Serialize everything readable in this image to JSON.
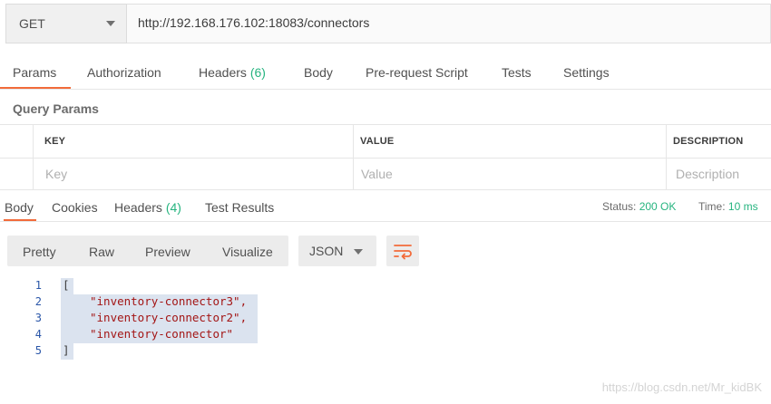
{
  "request": {
    "method": "GET",
    "url": "http://192.168.176.102:18083/connectors"
  },
  "request_tabs": [
    {
      "label": "Params"
    },
    {
      "label": "Authorization"
    },
    {
      "label": "Headers",
      "count": "(6)"
    },
    {
      "label": "Body"
    },
    {
      "label": "Pre-request Script"
    },
    {
      "label": "Tests"
    },
    {
      "label": "Settings"
    }
  ],
  "query_params": {
    "title": "Query Params",
    "columns": [
      "KEY",
      "VALUE",
      "DESCRIPTION"
    ],
    "placeholders": {
      "key": "Key",
      "value": "Value",
      "description": "Description"
    }
  },
  "response_tabs": [
    {
      "label": "Body"
    },
    {
      "label": "Cookies"
    },
    {
      "label": "Headers",
      "count": "(4)"
    },
    {
      "label": "Test Results"
    }
  ],
  "status": {
    "status_label": "Status:",
    "status_value": "200 OK",
    "time_label": "Time:",
    "time_value": "10 ms"
  },
  "view_modes": [
    "Pretty",
    "Raw",
    "Preview",
    "Visualize"
  ],
  "format_select": "JSON",
  "code": {
    "lines": [
      {
        "num": "1",
        "text": "["
      },
      {
        "num": "2",
        "text": "\"inventory-connector3\","
      },
      {
        "num": "3",
        "text": "\"inventory-connector2\","
      },
      {
        "num": "4",
        "text": "\"inventory-connector\""
      },
      {
        "num": "5",
        "text": "]"
      }
    ]
  },
  "watermark": "https://blog.csdn.net/Mr_kidBK",
  "colors": {
    "accent": "#f26b3a",
    "success": "#26b47f",
    "line_number": "#2a56a8",
    "string": "#a31515"
  }
}
